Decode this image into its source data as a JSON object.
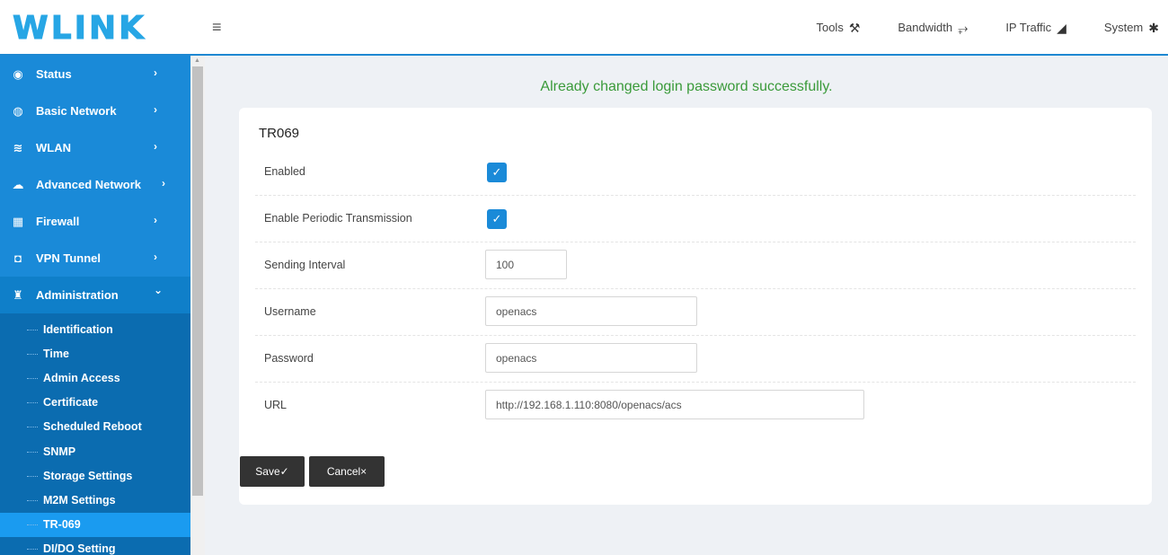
{
  "logo": {
    "text": "WLINK"
  },
  "header": {
    "menu_icon": "hamburger-icon",
    "nav": [
      {
        "label": "Tools",
        "icon": "tools-icon",
        "glyph": "⚒"
      },
      {
        "label": "Bandwidth",
        "icon": "line-chart-icon",
        "glyph": "⥅"
      },
      {
        "label": "IP Traffic",
        "icon": "area-chart-icon",
        "glyph": "◢"
      },
      {
        "label": "System",
        "icon": "gear-icon",
        "glyph": "✱"
      }
    ]
  },
  "sidebar": {
    "items": [
      {
        "label": "Status",
        "icon": "eye-icon",
        "glyph": "◉"
      },
      {
        "label": "Basic Network",
        "icon": "globe-icon",
        "glyph": "◍"
      },
      {
        "label": "WLAN",
        "icon": "wifi-icon",
        "glyph": "≋"
      },
      {
        "label": "Advanced Network",
        "icon": "cloud-icon",
        "glyph": "☁"
      },
      {
        "label": "Firewall",
        "icon": "firewall-icon",
        "glyph": "▦"
      },
      {
        "label": "VPN Tunnel",
        "icon": "vpn-icon",
        "glyph": "◘"
      },
      {
        "label": "Administration",
        "icon": "sitemap-icon",
        "glyph": "♜",
        "expanded": true
      }
    ],
    "chevron_right": "›",
    "chevron_down": "⌄",
    "submenu": [
      "Identification",
      "Time",
      "Admin Access",
      "Certificate",
      "Scheduled Reboot",
      "SNMP",
      "Storage Settings",
      "M2M Settings",
      "TR-069",
      "DI/DO Setting"
    ],
    "selected": "TR-069"
  },
  "main": {
    "message": "Already changed login password successfully.",
    "section_title": "TR069",
    "fields": {
      "enabled": {
        "label": "Enabled",
        "checked": true
      },
      "periodic": {
        "label": "Enable Periodic Transmission",
        "checked": true
      },
      "interval": {
        "label": "Sending Interval",
        "value": "100"
      },
      "username": {
        "label": "Username",
        "value": "openacs"
      },
      "password": {
        "label": "Password",
        "value": "openacs"
      },
      "url": {
        "label": "URL",
        "value": "http://192.168.1.110:8080/openacs/acs"
      }
    },
    "buttons": {
      "save": "Save✓",
      "cancel": "Cancel×"
    }
  },
  "colors": {
    "accent": "#1a8ad8",
    "success": "#3a9a3a",
    "logo": "#27a6e5"
  }
}
